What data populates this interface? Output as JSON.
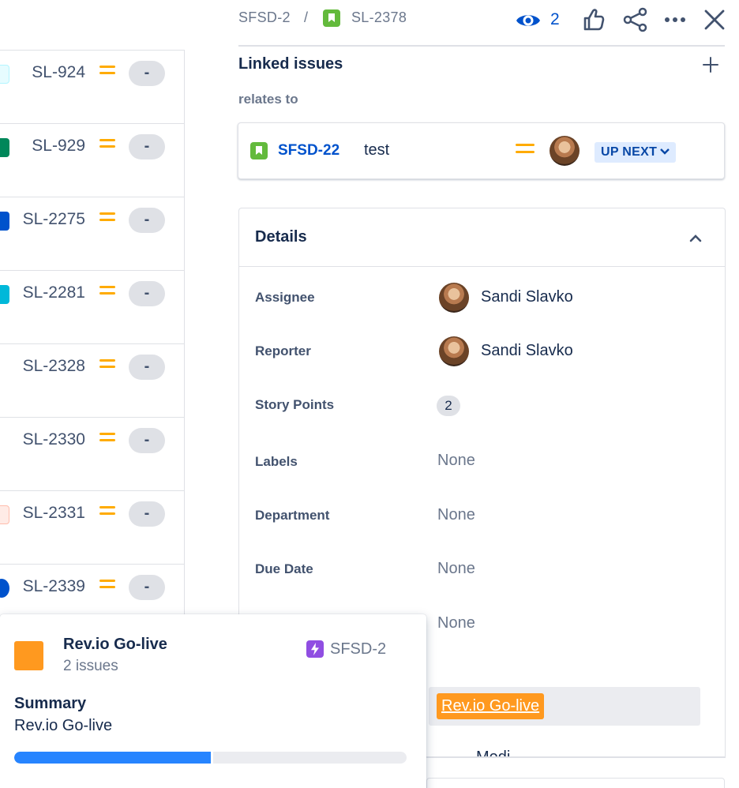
{
  "issue_list": [
    {
      "key": "SL-924",
      "icon_color": "#e6fcff",
      "icon_name": "subtask-icon",
      "status": "-"
    },
    {
      "key": "SL-929",
      "icon_color": "#00875a",
      "icon_name": "story-icon",
      "status": "-"
    },
    {
      "key": "SL-2275",
      "icon_color": "#0052cc",
      "icon_name": "task-icon",
      "status": "-"
    },
    {
      "key": "SL-2281",
      "icon_color": "#00b8d9",
      "icon_name": "subtask-icon",
      "status": "-"
    },
    {
      "key": "SL-2328",
      "icon_color": "#ffffff",
      "icon_name": "blank-icon",
      "status": "-"
    },
    {
      "key": "SL-2330",
      "icon_color": "#ffffff",
      "icon_name": "blank-icon",
      "status": "-"
    },
    {
      "key": "SL-2331",
      "icon_color": "#ffebe6",
      "icon_name": "bug-icon",
      "status": "-"
    },
    {
      "key": "SL-2339",
      "icon_color": "#0052cc",
      "icon_name": "task-icon",
      "status": "-"
    }
  ],
  "breadcrumb": {
    "parent_key": "SFSD-2",
    "separator": "/",
    "issue_key": "SL-2378"
  },
  "toolbar": {
    "watch_count": "2",
    "icons": [
      "eye-icon",
      "thumbs-up-icon",
      "share-icon",
      "more-icon",
      "close-icon"
    ]
  },
  "linked_issues": {
    "title": "Linked issues",
    "relation": "relates to",
    "items": [
      {
        "key": "SFSD-22",
        "summary": "test",
        "status": "UP NEXT"
      }
    ]
  },
  "details": {
    "title": "Details",
    "fields": {
      "assignee": {
        "label": "Assignee",
        "value": "Sandi Slavko"
      },
      "reporter": {
        "label": "Reporter",
        "value": "Sandi Slavko"
      },
      "story_points": {
        "label": "Story Points",
        "value": "2"
      },
      "labels": {
        "label": "Labels",
        "value": "None"
      },
      "department": {
        "label": "Department",
        "value": "None"
      },
      "due_date": {
        "label": "Due Date",
        "value": "None"
      },
      "hidden_field": {
        "value": "None"
      },
      "epic_link": {
        "value": "Rev.io Go-live"
      }
    }
  },
  "epic_card": {
    "name": "Rev.io Go-live",
    "issue_count": "2 issues",
    "key": "SFSD-2",
    "summary_label": "Summary",
    "summary_value": "Rev.io Go-live",
    "progress_done": 0.5
  },
  "colors": {
    "link_blue": "#0052cc",
    "priority_medium": "#ffab00",
    "epic_orange": "#ff991f",
    "progress_blue": "#2684ff",
    "story_green": "#63ba3c",
    "epic_purple": "#904ee2"
  }
}
